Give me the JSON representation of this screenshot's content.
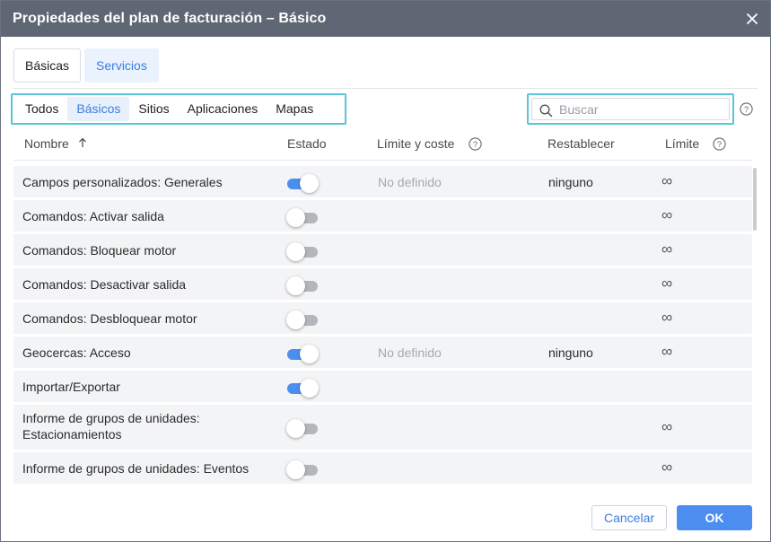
{
  "dialog": {
    "title": "Propiedades del plan de facturación – Básico"
  },
  "tabs": [
    {
      "label": "Básicas",
      "active": true
    },
    {
      "label": "Servicios",
      "active": false
    }
  ],
  "filters": [
    {
      "label": "Todos",
      "active": false
    },
    {
      "label": "Básicos",
      "active": true
    },
    {
      "label": "Sitios",
      "active": false
    },
    {
      "label": "Aplicaciones",
      "active": false
    },
    {
      "label": "Mapas",
      "active": false
    }
  ],
  "search": {
    "placeholder": "Buscar",
    "value": ""
  },
  "table": {
    "columns": {
      "name": "Nombre",
      "state": "Estado",
      "limit_cost": "Límite y coste",
      "reset": "Restablecer",
      "limit": "Límite"
    },
    "rows": [
      {
        "name": "Campos personalizados: Generales",
        "enabled": true,
        "limit_cost": "No definido",
        "reset": "ninguno",
        "limit": "∞"
      },
      {
        "name": "Comandos: Activar salida",
        "enabled": false,
        "limit_cost": "",
        "reset": "",
        "limit": "∞"
      },
      {
        "name": "Comandos: Bloquear motor",
        "enabled": false,
        "limit_cost": "",
        "reset": "",
        "limit": "∞"
      },
      {
        "name": "Comandos: Desactivar salida",
        "enabled": false,
        "limit_cost": "",
        "reset": "",
        "limit": "∞"
      },
      {
        "name": "Comandos: Desbloquear motor",
        "enabled": false,
        "limit_cost": "",
        "reset": "",
        "limit": "∞"
      },
      {
        "name": "Geocercas: Acceso",
        "enabled": true,
        "limit_cost": "No definido",
        "reset": "ninguno",
        "limit": "∞"
      },
      {
        "name": "Importar/Exportar",
        "enabled": true,
        "limit_cost": "",
        "reset": "",
        "limit": ""
      },
      {
        "name": "Informe de grupos de unidades:",
        "name_line2": "Estacionamientos",
        "enabled": false,
        "limit_cost": "",
        "reset": "",
        "limit": "∞"
      },
      {
        "name": "Informe de grupos de unidades: Eventos",
        "enabled": false,
        "limit_cost": "",
        "reset": "",
        "limit": "∞"
      }
    ]
  },
  "footer": {
    "cancel_label": "Cancelar",
    "ok_label": "OK"
  },
  "colors": {
    "titlebar": "#5f6774",
    "accent": "#4c8ef0",
    "highlight_border": "#58c6d8",
    "toggle_off": "#b3b6ba"
  }
}
